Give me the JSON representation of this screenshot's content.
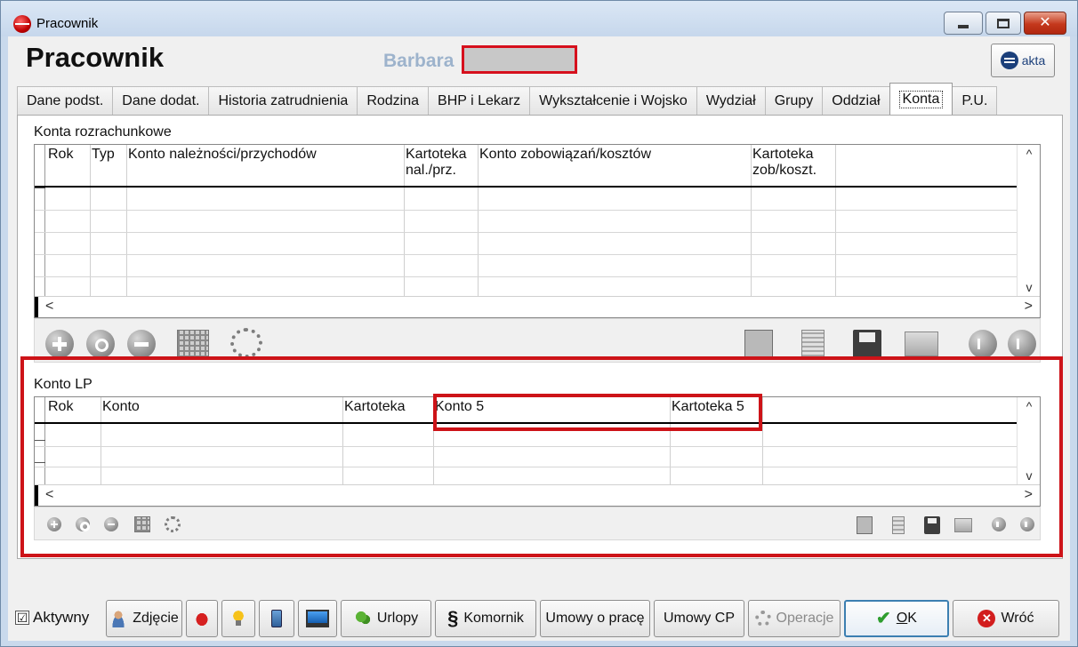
{
  "window": {
    "title": "Pracownik"
  },
  "header": {
    "page_title": "Pracownik",
    "employee_name": "Barbara",
    "eakta_label": "akta"
  },
  "tabs": [
    {
      "label": "Dane podst."
    },
    {
      "label": "Dane dodat."
    },
    {
      "label": "Historia zatrudnienia"
    },
    {
      "label": "Rodzina"
    },
    {
      "label": "BHP i Lekarz"
    },
    {
      "label": "Wykształcenie i Wojsko"
    },
    {
      "label": "Wydział"
    },
    {
      "label": "Grupy"
    },
    {
      "label": "Oddział"
    },
    {
      "label": "Konta"
    },
    {
      "label": "P.U."
    }
  ],
  "active_tab": "Konta",
  "konta_rozrachunkowe": {
    "label": "Konta rozrachunkowe",
    "columns": [
      "Rok",
      "Typ",
      "Konto należności/przychodów",
      "Kartoteka nal./prz.",
      "Konto zobowiązań/kosztów",
      "Kartoteka zob/koszt."
    ]
  },
  "konto_lp": {
    "label": "Konto LP",
    "columns": [
      "Rok",
      "Konto",
      "Kartoteka",
      "Konto 5",
      "Kartoteka 5"
    ]
  },
  "scroll": {
    "left": "<",
    "right": ">",
    "up": "^",
    "down": "v"
  },
  "footer": {
    "aktywny_label": "Aktywny",
    "aktywny_checked": "☑",
    "zdjecie": "Zdjęcie",
    "urlopy": "Urlopy",
    "komornik": "Komornik",
    "umowy_o_prace": "Umowy o pracę",
    "umowy_cp": "Umowy CP",
    "operacje": "Operacje",
    "ok": "OK",
    "wroc": "Wróć"
  },
  "icons": {
    "window_close": "✕"
  },
  "colors": {
    "highlight_red": "#cd1318",
    "name_color": "#9db3cc",
    "primary_border": "#3c7fb1"
  }
}
